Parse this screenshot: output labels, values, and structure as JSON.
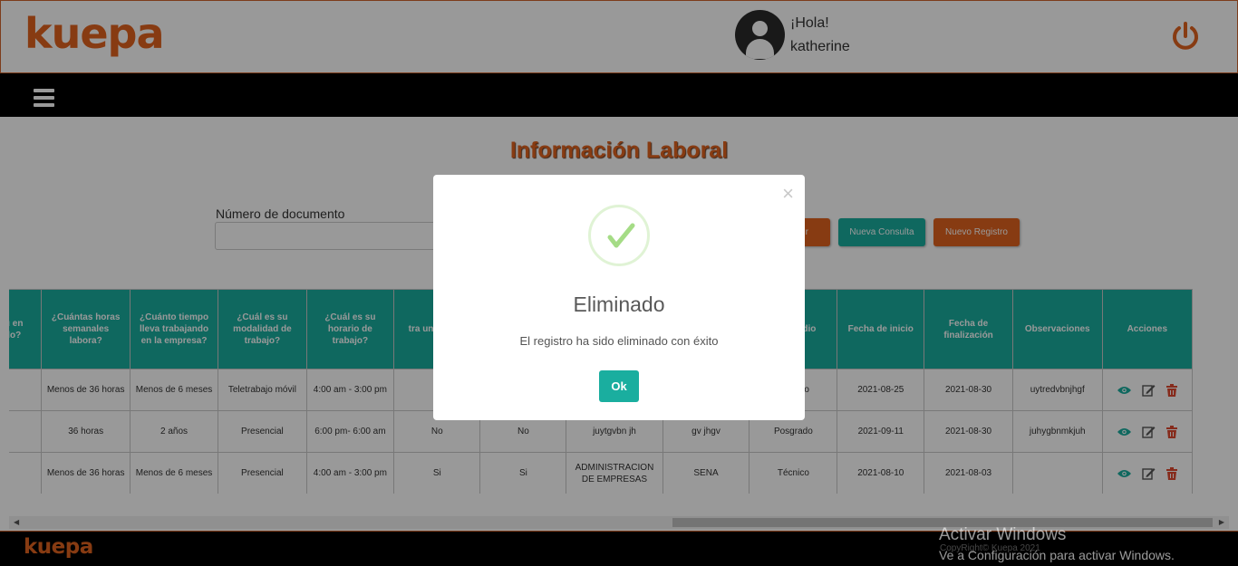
{
  "header": {
    "logo": "kuepa",
    "greeting": "¡Hola!",
    "username": "katherine"
  },
  "page": {
    "title": "Información Laboral",
    "doc_label": "Número de documento",
    "doc_value": "",
    "search_label": "r",
    "new_query_label": "Nueva Consulta",
    "new_record_label": "Nuevo Registro"
  },
  "table": {
    "headers": [
      "e su\nen\ngado?",
      "¿Cuántas horas semanales labora?",
      "¿Cuánto tiempo lleva trabajando en la empresa?",
      "¿Cuál es su modalidad de trabajo?",
      "¿Cuál es su horario de trabajo?",
      "tra\nun\nrela\nqu",
      "",
      "",
      "",
      "de estudio",
      "Fecha de inicio",
      "Fecha de finalización",
      "Observaciones",
      "Acciones"
    ],
    "rows": [
      [
        "",
        "Menos de 36 horas",
        "Menos de 6 meses",
        "Teletrabajo móvil",
        "4:00 am - 3:00 pm",
        "",
        "",
        "",
        "",
        "Técnico",
        "2021-08-25",
        "2021-08-30",
        "uytredvbnjhgf"
      ],
      [
        "",
        "36 horas",
        "2 años",
        "Presencial",
        "6:00 pm- 6:00 am",
        "No",
        "No",
        "juytgvbn jh",
        "gv jhgv",
        "Posgrado",
        "2021-09-11",
        "2021-08-30",
        "juhygbnmkjuh"
      ],
      [
        "",
        "Menos de 36 horas",
        "Menos de 6 meses",
        "Presencial",
        "4:00 am - 3:00 pm",
        "Si",
        "Si",
        "ADMINISTRACION DE EMPRESAS",
        "SENA",
        "Técnico",
        "2021-08-10",
        "2021-08-03",
        ""
      ]
    ]
  },
  "footer": {
    "logo": "kuepa",
    "copyright": "CopyRight© Kuepa 2021"
  },
  "watermark": {
    "line1": "Activar Windows",
    "line2": "Ve a Configuración para activar Windows."
  },
  "modal": {
    "close": "×",
    "title": "Eliminado",
    "message": "El registro ha sido eliminado con éxito",
    "ok_label": "Ok"
  },
  "colors": {
    "brand": "#e2631f",
    "teal": "#1aae9f",
    "success": "#a5dc86"
  }
}
